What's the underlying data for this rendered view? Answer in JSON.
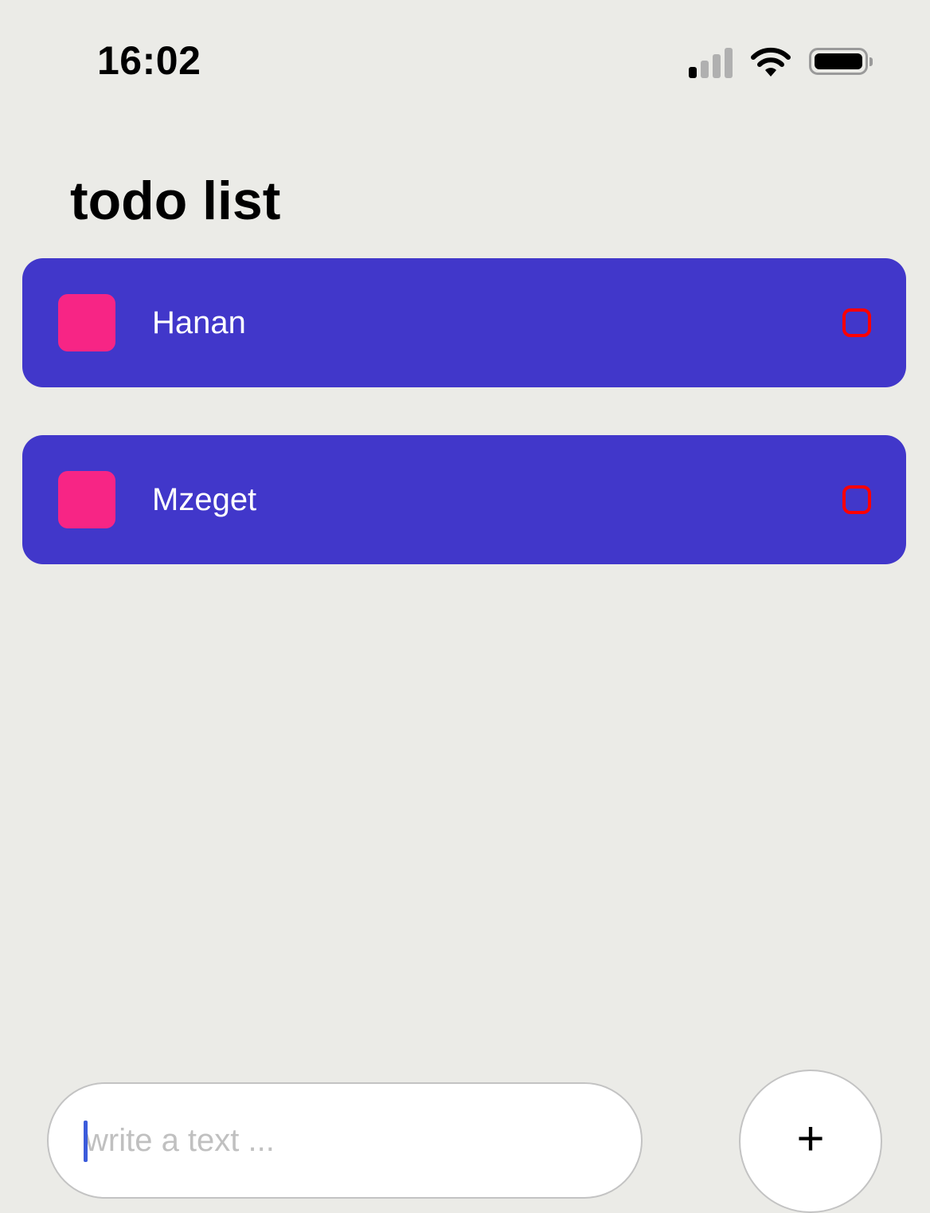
{
  "status_bar": {
    "time": "16:02",
    "icons": [
      "cellular-signal-icon",
      "wifi-icon",
      "battery-icon"
    ]
  },
  "header": {
    "title": "todo list"
  },
  "todos": [
    {
      "label": "Hanan"
    },
    {
      "label": "Mzeget"
    }
  ],
  "composer": {
    "input_value": "",
    "placeholder": "write a text ...",
    "add_label": "+"
  },
  "colors": {
    "background": "#EBEBE7",
    "card": "#4137CA",
    "square": "#F72585",
    "circle_border": "#FF0000",
    "caret": "#3B5BDB"
  }
}
